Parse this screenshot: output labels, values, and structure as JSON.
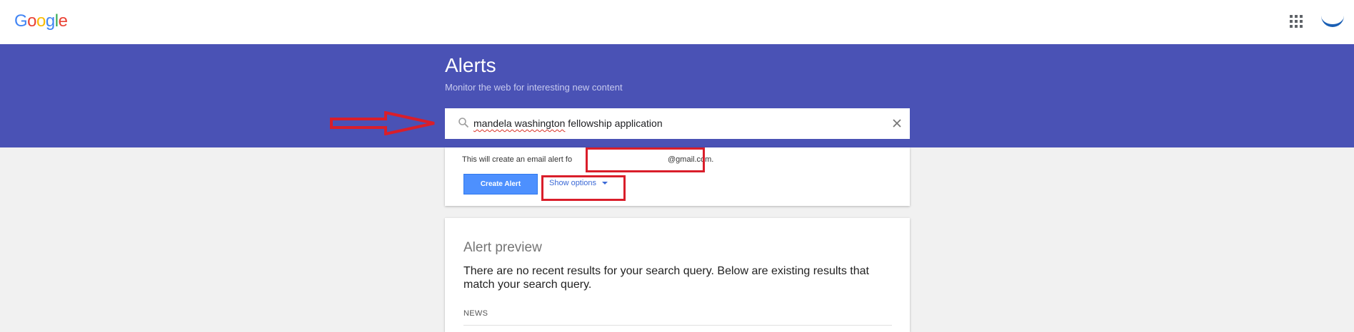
{
  "header": {
    "logo_letters": [
      {
        "ch": "G",
        "color": "#4285F4"
      },
      {
        "ch": "o",
        "color": "#EA4335"
      },
      {
        "ch": "o",
        "color": "#FBBC05"
      },
      {
        "ch": "g",
        "color": "#4285F4"
      },
      {
        "ch": "l",
        "color": "#34A853"
      },
      {
        "ch": "e",
        "color": "#EA4335"
      }
    ],
    "apps_icon": "apps-grid-icon"
  },
  "banner": {
    "title": "Alerts",
    "subtitle": "Monitor the web for interesting new content",
    "color": "#4a52b5"
  },
  "search": {
    "query_part1": "mandela washington",
    "query_part2": " fellowship application",
    "search_icon": "search-icon",
    "clear_icon": "close-icon"
  },
  "create_card": {
    "email_text": "This will create an email alert fo",
    "email_value": "@gmail.com.",
    "create_label": "Create Alert",
    "show_options_label": "Show options"
  },
  "preview_card": {
    "title": "Alert preview",
    "message": "There are no recent results for your search query. Below are existing results that match your search query.",
    "section_label": "NEWS"
  },
  "annotation_color": "#d91e2a"
}
